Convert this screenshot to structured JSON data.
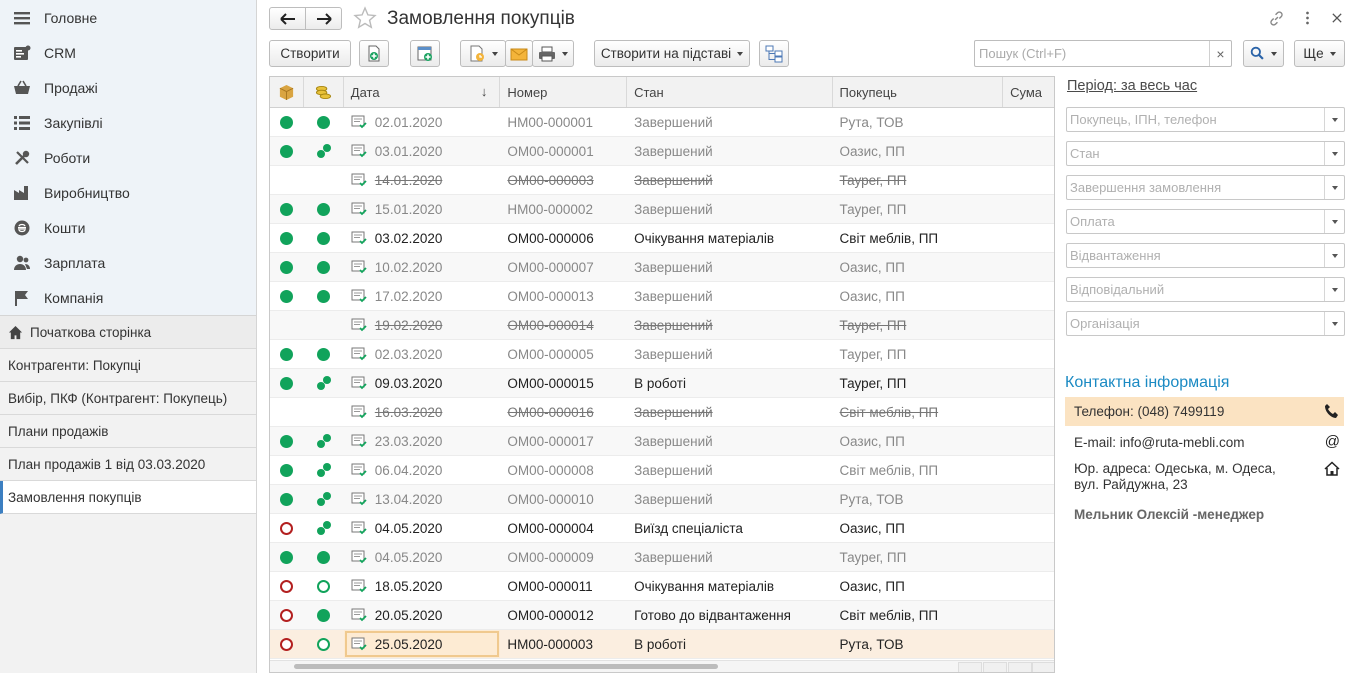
{
  "sidebar": {
    "sections": [
      {
        "label": "Головне",
        "icon": "menu-lines-icon"
      },
      {
        "label": "CRM",
        "icon": "crm-icon"
      },
      {
        "label": "Продажі",
        "icon": "basket-icon"
      },
      {
        "label": "Закупівлі",
        "icon": "purchases-icon"
      },
      {
        "label": "Роботи",
        "icon": "tools-icon"
      },
      {
        "label": "Виробництво",
        "icon": "factory-icon"
      },
      {
        "label": "Кошти",
        "icon": "money-icon"
      },
      {
        "label": "Зарплата",
        "icon": "people-icon"
      },
      {
        "label": "Компанія",
        "icon": "flag-icon"
      }
    ],
    "open_windows": [
      {
        "label": "Початкова сторінка"
      },
      {
        "label": "Контрагенти: Покупці"
      },
      {
        "label": "Вибір, ПКФ (Контрагент: Покупець)"
      },
      {
        "label": "Плани продажів"
      },
      {
        "label": "План продажів 1 від 03.03.2020"
      },
      {
        "label": "Замовлення покупців"
      }
    ]
  },
  "header": {
    "title": "Замовлення покупців"
  },
  "toolbar": {
    "create_label": "Створити",
    "create_based_label": "Створити на підставі",
    "search_placeholder": "Пошук (Ctrl+F)",
    "search_clear": "×",
    "more_label": "Ще"
  },
  "table": {
    "columns": {
      "date": "Дата",
      "number": "Номер",
      "state": "Стан",
      "buyer": "Покупець",
      "sum": "Сума"
    },
    "sort_indicator": "↓",
    "rows": [
      {
        "s1": "full",
        "s2": "full",
        "date": "02.01.2020",
        "number": "НМ00-000001",
        "state": "Завершений",
        "buyer": "Рута, ТОВ",
        "style": "normal"
      },
      {
        "s1": "full",
        "s2": "part",
        "date": "03.01.2020",
        "number": "ОМ00-000001",
        "state": "Завершений",
        "buyer": "Оазис, ПП",
        "style": "normal"
      },
      {
        "s1": "none",
        "s2": "none",
        "date": "14.01.2020",
        "number": "ОМ00-000003",
        "state": "Завершений",
        "buyer": "Таурег, ПП",
        "style": "deleted"
      },
      {
        "s1": "full",
        "s2": "full",
        "date": "15.01.2020",
        "number": "НМ00-000002",
        "state": "Завершений",
        "buyer": "Таурег, ПП",
        "style": "normal"
      },
      {
        "s1": "full",
        "s2": "full",
        "date": "03.02.2020",
        "number": "ОМ00-000006",
        "state": "Очікування матеріалів",
        "buyer": "Світ меблів, ПП",
        "style": "bold"
      },
      {
        "s1": "full",
        "s2": "full",
        "date": "10.02.2020",
        "number": "ОМ00-000007",
        "state": "Завершений",
        "buyer": "Оазис, ПП",
        "style": "normal"
      },
      {
        "s1": "full",
        "s2": "full",
        "date": "17.02.2020",
        "number": "ОМ00-000013",
        "state": "Завершений",
        "buyer": "Оазис, ПП",
        "style": "normal"
      },
      {
        "s1": "none",
        "s2": "none",
        "date": "19.02.2020",
        "number": "ОМ00-000014",
        "state": "Завершений",
        "buyer": "Таурег, ПП",
        "style": "deleted"
      },
      {
        "s1": "full",
        "s2": "full",
        "date": "02.03.2020",
        "number": "ОМ00-000005",
        "state": "Завершений",
        "buyer": "Таурег, ПП",
        "style": "normal"
      },
      {
        "s1": "full",
        "s2": "part",
        "date": "09.03.2020",
        "number": "ОМ00-000015",
        "state": "В роботі",
        "buyer": "Таурег, ПП",
        "style": "bold"
      },
      {
        "s1": "none",
        "s2": "none",
        "date": "16.03.2020",
        "number": "ОМ00-000016",
        "state": "Завершений",
        "buyer": "Світ меблів, ПП",
        "style": "deleted"
      },
      {
        "s1": "full",
        "s2": "part",
        "date": "23.03.2020",
        "number": "ОМ00-000017",
        "state": "Завершений",
        "buyer": "Оазис, ПП",
        "style": "normal"
      },
      {
        "s1": "full",
        "s2": "part",
        "date": "06.04.2020",
        "number": "ОМ00-000008",
        "state": "Завершений",
        "buyer": "Світ меблів, ПП",
        "style": "normal"
      },
      {
        "s1": "full",
        "s2": "part",
        "date": "13.04.2020",
        "number": "ОМ00-000010",
        "state": "Завершений",
        "buyer": "Рута, ТОВ",
        "style": "normal"
      },
      {
        "s1": "red",
        "s2": "part",
        "date": "04.05.2020",
        "number": "ОМ00-000004",
        "state": "Виїзд спеціаліста",
        "buyer": "Оазис, ПП",
        "style": "bold"
      },
      {
        "s1": "full",
        "s2": "full",
        "date": "04.05.2020",
        "number": "ОМ00-000009",
        "state": "Завершений",
        "buyer": "Таурег, ПП",
        "style": "normal"
      },
      {
        "s1": "red",
        "s2": "empty",
        "date": "18.05.2020",
        "number": "ОМ00-000011",
        "state": "Очікування матеріалів",
        "buyer": "Оазис, ПП",
        "style": "bold"
      },
      {
        "s1": "red",
        "s2": "full",
        "date": "20.05.2020",
        "number": "ОМ00-000012",
        "state": "Готово до відвантаження",
        "buyer": "Світ меблів, ПП",
        "style": "bold"
      },
      {
        "s1": "red",
        "s2": "empty",
        "date": "25.05.2020",
        "number": "НМ00-000003",
        "state": "В роботі",
        "buyer": "Рута, ТОВ",
        "style": "selected"
      }
    ]
  },
  "right_panel": {
    "period_label": "Період: за весь час",
    "filters": [
      {
        "placeholder": "Покупець, ІПН, телефон"
      },
      {
        "placeholder": "Стан"
      },
      {
        "placeholder": "Завершення замовлення"
      },
      {
        "placeholder": "Оплата"
      },
      {
        "placeholder": "Відвантаження"
      },
      {
        "placeholder": "Відповідальний"
      },
      {
        "placeholder": "Організація"
      }
    ],
    "contact_title": "Контактна інформація",
    "phone": "Телефон: (048) 7499119",
    "email": "E-mail: info@ruta-mebli.com",
    "address": "Юр. адреса: Одеська, м. Одеса, вул. Райдужна, 23",
    "manager": "Мельник Олексій -менеджер"
  },
  "colors": {
    "accent": "#1b8ac3",
    "status_green": "#11a35b",
    "status_red": "#b32020",
    "selection": "#fbeee0"
  }
}
